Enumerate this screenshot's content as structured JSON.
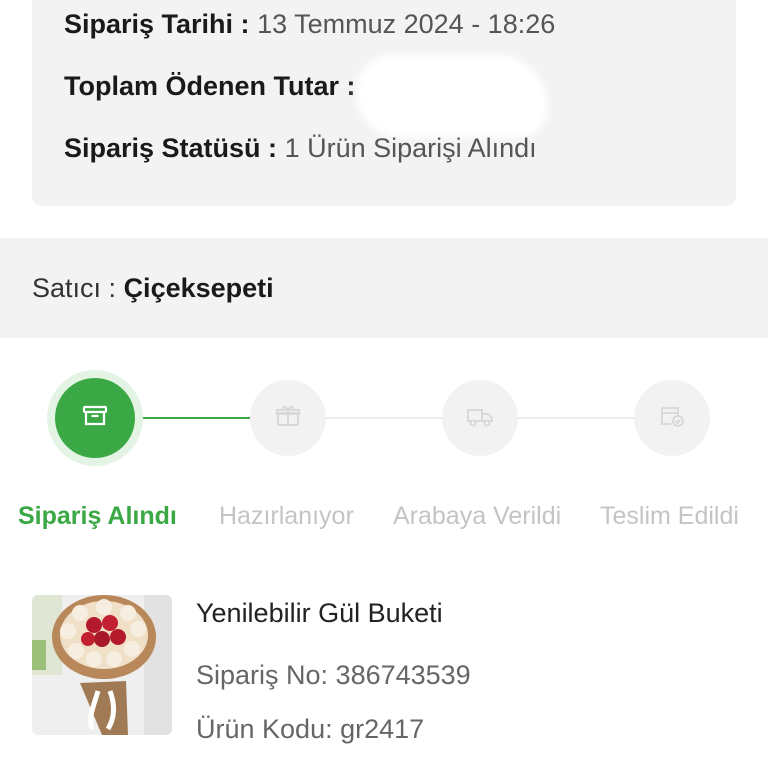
{
  "summary": {
    "date_label": "Sipariş Tarihi :",
    "date_value": "13 Temmuz 2024 - 18:26",
    "total_label": "Toplam Ödenen Tutar :",
    "status_label": "Sipariş Statüsü :",
    "status_value": "1 Ürün Siparişi Alındı"
  },
  "seller": {
    "label": "Satıcı :",
    "name": "Çiçeksepeti"
  },
  "tracker": {
    "steps": [
      {
        "label": "Sipariş Alındı",
        "icon": "archive-box-icon",
        "active": true
      },
      {
        "label": "Hazırlanıyor",
        "icon": "gift-box-icon",
        "active": false
      },
      {
        "label": "Arabaya Verildi",
        "icon": "delivery-truck-icon",
        "active": false
      },
      {
        "label": "Teslim Edildi",
        "icon": "box-check-icon",
        "active": false
      }
    ],
    "completed_fraction": 0.333
  },
  "product": {
    "title": "Yenilebilir Gül Buketi",
    "order_no": "Sipariş No: 386743539",
    "product_code": "Ürün Kodu: gr2417"
  },
  "colors": {
    "accent": "#3aa845",
    "inactive": "#c4c4c4",
    "panel": "#f3f3f3"
  }
}
